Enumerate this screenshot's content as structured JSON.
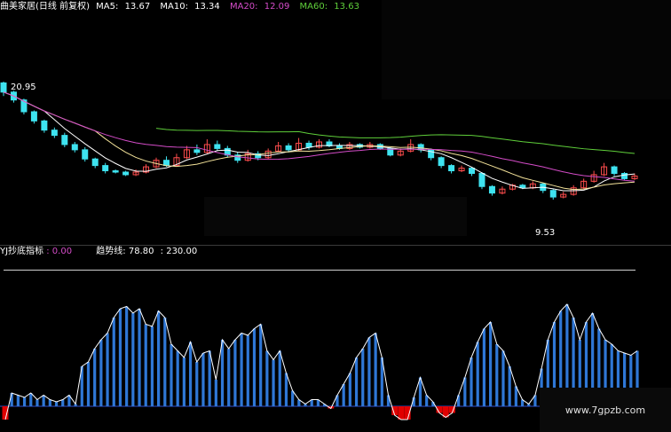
{
  "main_panel": {
    "stock_name": "曲美家居",
    "period": "(日线 前复权)",
    "ma5": {
      "label": "MA5:",
      "value": "13.67",
      "color": "#ffffff"
    },
    "ma10": {
      "label": "MA10:",
      "value": "13.34",
      "color": "#f4e39a"
    },
    "ma20": {
      "label": "MA20:",
      "value": "12.09",
      "color": "#d44cc8"
    },
    "ma60": {
      "label": "MA60:",
      "value": "13.63",
      "color": "#5fcf3a"
    },
    "high_marker": "20.95",
    "low_marker": "9.53"
  },
  "indicator_panel": {
    "name": "YJ抄底指标",
    "value1": ": 0.00",
    "trend_label": "趋势线:",
    "trend_value": "78.80",
    "level_value": ": 230.00"
  },
  "colors": {
    "up": "#ff4d4d",
    "down": "#3ee3f0",
    "bar": "#2f77d6",
    "negative": "#e00000",
    "trend_line": "#ffffff"
  },
  "chart_data": [
    {
      "type": "candlestick",
      "title": "曲美家居",
      "series": [
        {
          "name": "MA5",
          "last": 13.67
        },
        {
          "name": "MA10",
          "last": 13.34
        },
        {
          "name": "MA20",
          "last": 12.09
        },
        {
          "name": "MA60",
          "last": 13.63
        }
      ],
      "annotations": [
        "20.95",
        "9.53"
      ]
    },
    {
      "type": "bar",
      "title": "YJ抄底指标",
      "values": [
        -6,
        6,
        5,
        4,
        6,
        3,
        5,
        3,
        2,
        3,
        5,
        1,
        18,
        20,
        26,
        30,
        33,
        40,
        44,
        45,
        42,
        44,
        37,
        36,
        43,
        40,
        28,
        25,
        22,
        29,
        20,
        24,
        25,
        12,
        30,
        26,
        30,
        33,
        32,
        35,
        37,
        25,
        21,
        25,
        15,
        7,
        3,
        1,
        3,
        3,
        1,
        -1,
        5,
        10,
        15,
        22,
        26,
        31,
        33,
        22,
        5,
        -4,
        -6,
        -6,
        4,
        13,
        5,
        2,
        -3,
        -5,
        -3,
        5,
        13,
        22,
        29,
        35,
        38,
        28,
        25,
        18,
        9,
        3,
        1,
        5,
        17,
        30,
        38,
        43,
        46,
        40,
        30,
        38,
        42,
        35,
        30,
        28,
        25,
        24,
        23,
        25
      ],
      "trend_line": [
        -6,
        6,
        5,
        4,
        6,
        3,
        5,
        3,
        2,
        3,
        5,
        1,
        18,
        20,
        26,
        30,
        33,
        40,
        44,
        45,
        42,
        44,
        37,
        36,
        43,
        40,
        28,
        25,
        22,
        29,
        20,
        24,
        25,
        12,
        30,
        26,
        30,
        33,
        32,
        35,
        37,
        25,
        21,
        25,
        15,
        7,
        3,
        1,
        3,
        3,
        1,
        -1,
        5,
        10,
        15,
        22,
        26,
        31,
        33,
        22,
        5,
        -4,
        -6,
        -6,
        4,
        13,
        5,
        2,
        -3,
        -5,
        -3,
        5,
        13,
        22,
        29,
        35,
        38,
        28,
        25,
        18,
        9,
        3,
        1,
        5,
        17,
        30,
        38,
        43,
        46,
        40,
        30,
        38,
        42,
        35,
        30,
        28,
        25,
        24,
        23,
        25
      ]
    }
  ]
}
